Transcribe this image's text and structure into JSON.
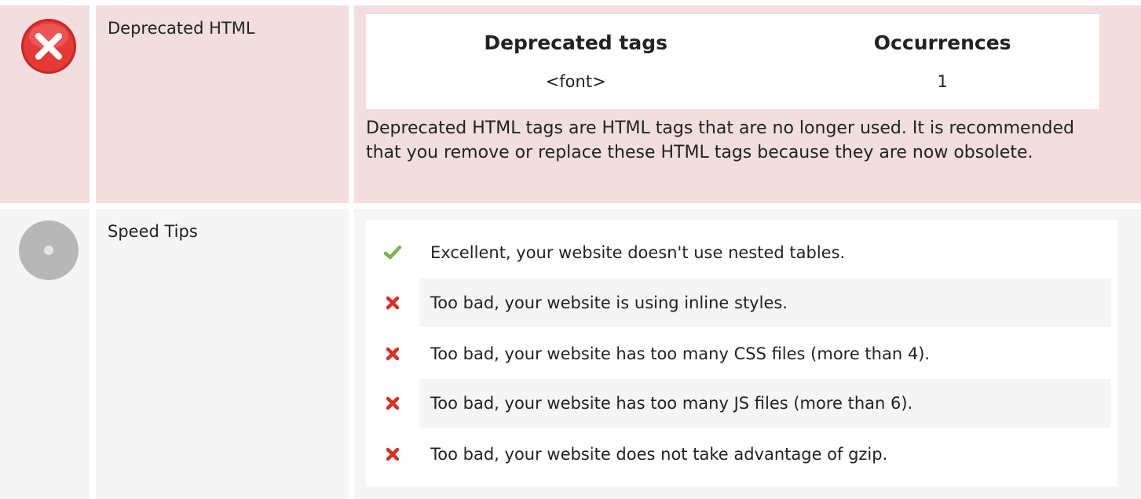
{
  "deprecated_html": {
    "status": "error",
    "status_color": "#e74c3c",
    "label": "Deprecated HTML",
    "table": {
      "headers": [
        "Deprecated tags",
        "Occurrences"
      ],
      "rows": [
        {
          "tag": "<font>",
          "count": "1"
        }
      ]
    },
    "description": "Deprecated HTML tags are HTML tags that are no longer used. It is recommended that you remove or replace these HTML tags because they are now obsolete."
  },
  "speed_tips": {
    "status": "neutral",
    "status_color": "#b3b3b3",
    "label": "Speed Tips",
    "tips": [
      {
        "status": "pass",
        "icon": "check-icon",
        "text": "Excellent, your website doesn't use nested tables."
      },
      {
        "status": "fail",
        "icon": "cross-icon",
        "text": "Too bad, your website is using inline styles."
      },
      {
        "status": "fail",
        "icon": "cross-icon",
        "text": "Too bad, your website has too many CSS files (more than 4)."
      },
      {
        "status": "fail",
        "icon": "cross-icon",
        "text": "Too bad, your website has too many JS files (more than 6)."
      },
      {
        "status": "fail",
        "icon": "cross-icon",
        "text": "Too bad, your website does not take advantage of gzip."
      }
    ]
  },
  "colors": {
    "error_row_bg": "#f2dedf",
    "neutral_row_bg": "#f5f5f5",
    "pass": "#7ab648",
    "fail": "#d93025"
  }
}
